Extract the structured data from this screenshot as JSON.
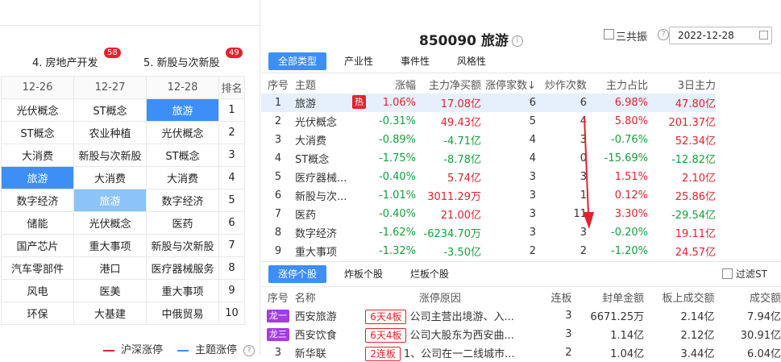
{
  "left": {
    "tabs": [
      {
        "label": "4. 房地产开发",
        "badge": "58"
      },
      {
        "label": "5. 新股与次新股",
        "badge": "49"
      }
    ],
    "grid": {
      "headers": [
        "12-26",
        "12-27",
        "12-28",
        "排名"
      ],
      "rows": [
        [
          "光伏概念",
          "ST概念",
          "旅游",
          "1"
        ],
        [
          "ST概念",
          "农业种植",
          "光伏概念",
          "2"
        ],
        [
          "大消费",
          "新股与次新股",
          "ST概念",
          "3"
        ],
        [
          "旅游",
          "大消费",
          "大消费",
          "4"
        ],
        [
          "数字经济",
          "旅游",
          "数字经济",
          "5"
        ],
        [
          "储能",
          "光伏概念",
          "医药",
          "6"
        ],
        [
          "国产芯片",
          "重大事项",
          "新股与次新股",
          "7"
        ],
        [
          "汽车零部件",
          "港口",
          "医疗器械服务",
          "8"
        ],
        [
          "风电",
          "医美",
          "重大事项",
          "9"
        ],
        [
          "环保",
          "大基建",
          "中俄贸易",
          "10"
        ]
      ],
      "highlighted_cells": [
        {
          "row": 0,
          "col": 2,
          "style": "selected"
        },
        {
          "row": 3,
          "col": 0,
          "style": "selected"
        },
        {
          "row": 4,
          "col": 1,
          "style": "light"
        }
      ]
    },
    "legend": {
      "item1": "沪深涨停",
      "item1_color": "#e4222d",
      "item2": "主题涨停",
      "item2_color": "#3e8ef7",
      "info_icon": "?"
    }
  },
  "right": {
    "title": "850090 旅游",
    "info_icon": "i",
    "gongzhen_label": "三共振",
    "help_icon": "?",
    "date": "2022-12-28",
    "tabs": [
      "全部类型",
      "产业性",
      "事件性",
      "风格性"
    ],
    "theme_table": {
      "headers": [
        "序号",
        "主题",
        "涨幅",
        "主力净买额",
        "涨停家数↓",
        "炒作次数",
        "主力占比",
        "3日主力"
      ],
      "rows": [
        {
          "idx": "1",
          "name": "旅游",
          "hot": "热",
          "chg": "1.06%",
          "net": "17.08亿",
          "limit": "6",
          "times": "6",
          "ratio": "6.98%",
          "d3": "47.80亿"
        },
        {
          "idx": "2",
          "name": "光伏概念",
          "hot": "",
          "chg": "-0.31%",
          "net": "49.43亿",
          "limit": "5",
          "times": "4",
          "ratio": "5.80%",
          "d3": "201.37亿"
        },
        {
          "idx": "3",
          "name": "大消费",
          "hot": "",
          "chg": "-0.89%",
          "net": "-4.71亿",
          "limit": "4",
          "times": "3",
          "ratio": "-0.76%",
          "d3": "52.34亿"
        },
        {
          "idx": "4",
          "name": "ST概念",
          "hot": "",
          "chg": "-1.75%",
          "net": "-8.78亿",
          "limit": "4",
          "times": "0",
          "ratio": "-15.69%",
          "d3": "-12.82亿"
        },
        {
          "idx": "5",
          "name": "医疗器械...",
          "hot": "",
          "chg": "-0.40%",
          "net": "5.74亿",
          "limit": "3",
          "times": "3",
          "ratio": "1.51%",
          "d3": "2.10亿"
        },
        {
          "idx": "6",
          "name": "新股与次...",
          "hot": "",
          "chg": "-1.01%",
          "net": "3011.29万",
          "limit": "3",
          "times": "1",
          "ratio": "0.12%",
          "d3": "25.86亿"
        },
        {
          "idx": "7",
          "name": "医药",
          "hot": "",
          "chg": "-0.40%",
          "net": "21.00亿",
          "limit": "3",
          "times": "11",
          "ratio": "3.30%",
          "d3": "-29.54亿"
        },
        {
          "idx": "8",
          "name": "数字经济",
          "hot": "",
          "chg": "-1.62%",
          "net": "-6234.70万",
          "limit": "3",
          "times": "3",
          "ratio": "-0.20%",
          "d3": "19.11亿"
        },
        {
          "idx": "9",
          "name": "重大事项",
          "hot": "",
          "chg": "-1.32%",
          "net": "-3.50亿",
          "limit": "2",
          "times": "2",
          "ratio": "-1.20%",
          "d3": "24.57亿"
        }
      ]
    },
    "tabs2": [
      "涨停个股",
      "炸板个股",
      "烂板个股"
    ],
    "filter_st": "过滤ST",
    "stock_table": {
      "headers": [
        "序号",
        "名称",
        "涨停原因",
        "连板",
        "封单金额",
        "板上成交额",
        "成交额"
      ],
      "rows": [
        {
          "idx": "龙一",
          "name": "西安旅游",
          "board": "6天4板",
          "reason": "公司主营出境游、入...",
          "lianban": "3",
          "seal": "6671.25万",
          "onboard": "2.14亿",
          "turnover": "7.94亿"
        },
        {
          "idx": "龙三",
          "name": "西安饮食",
          "board": "6天4板",
          "reason": "公司大股东为西安曲...",
          "lianban": "3",
          "seal": "1.14亿",
          "onboard": "2.12亿",
          "turnover": "30.91亿"
        },
        {
          "idx": "3",
          "name": "新华联",
          "board": "2连板",
          "reason": "1、公司在一二线城市...",
          "lianban": "2",
          "seal": "1.04亿",
          "onboard": "3.44亿",
          "turnover": "6.04亿"
        }
      ]
    }
  }
}
